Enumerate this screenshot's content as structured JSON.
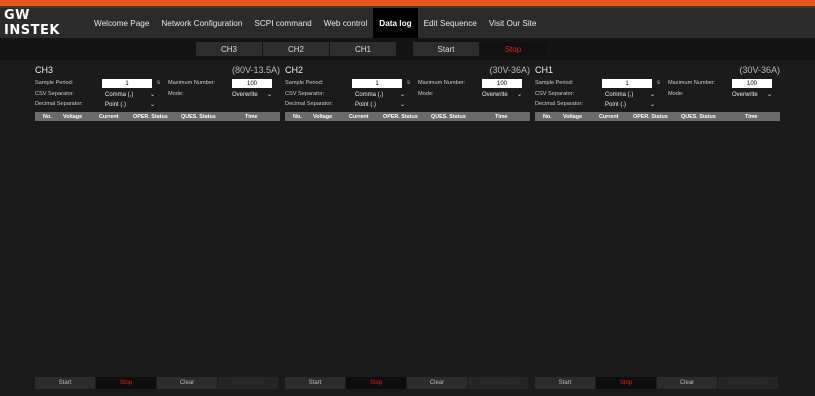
{
  "brand": {
    "logo": "GW INSTEK",
    "accent_color": "#e8581a"
  },
  "nav": {
    "items": [
      {
        "label": "Welcome Page"
      },
      {
        "label": "Network Configuration"
      },
      {
        "label": "SCPI command"
      },
      {
        "label": "Web control"
      },
      {
        "label": "Data log",
        "active": true
      },
      {
        "label": "Edit Sequence"
      },
      {
        "label": "Visit Our Site"
      }
    ]
  },
  "tabs": {
    "ch3": "CH3",
    "ch2": "CH2",
    "ch1": "CH1",
    "start": "Start",
    "stop": "Stop"
  },
  "labels": {
    "sample_period": "Sample Period:",
    "maximum_number": "Maximum Number:",
    "csv_separator": "CSV Separator:",
    "mode": "Mode:",
    "decimal_separator": "Decimal Separator:",
    "unit_s": "s"
  },
  "table_headers": [
    "No.",
    "Voltage",
    "Current",
    "OPER. Status",
    "QUES. Status",
    "Time"
  ],
  "panels": [
    {
      "name": "CH3",
      "range": "(80V-13.5A)",
      "sample_period": "1",
      "maximum_number": "100",
      "csv_separator": "Comma (,)",
      "mode": "Overwrite",
      "decimal_separator": "Point (.)",
      "buttons": {
        "start": "Start",
        "stop": "Stop",
        "clear": "Clear",
        "save": "Save to CSV"
      }
    },
    {
      "name": "CH2",
      "range": "(30V-36A)",
      "sample_period": "1",
      "maximum_number": "100",
      "csv_separator": "Comma (,)",
      "mode": "Overwrite",
      "decimal_separator": "Point (.)",
      "buttons": {
        "start": "Start",
        "stop": "Stop",
        "clear": "Clear",
        "save": "Save to CSV"
      }
    },
    {
      "name": "CH1",
      "range": "(30V-36A)",
      "sample_period": "1",
      "maximum_number": "100",
      "csv_separator": "Comma (,)",
      "mode": "Overwrite",
      "decimal_separator": "Point (.)",
      "buttons": {
        "start": "Start",
        "stop": "Stop",
        "clear": "Clear",
        "save": "Save to CSV"
      }
    }
  ]
}
